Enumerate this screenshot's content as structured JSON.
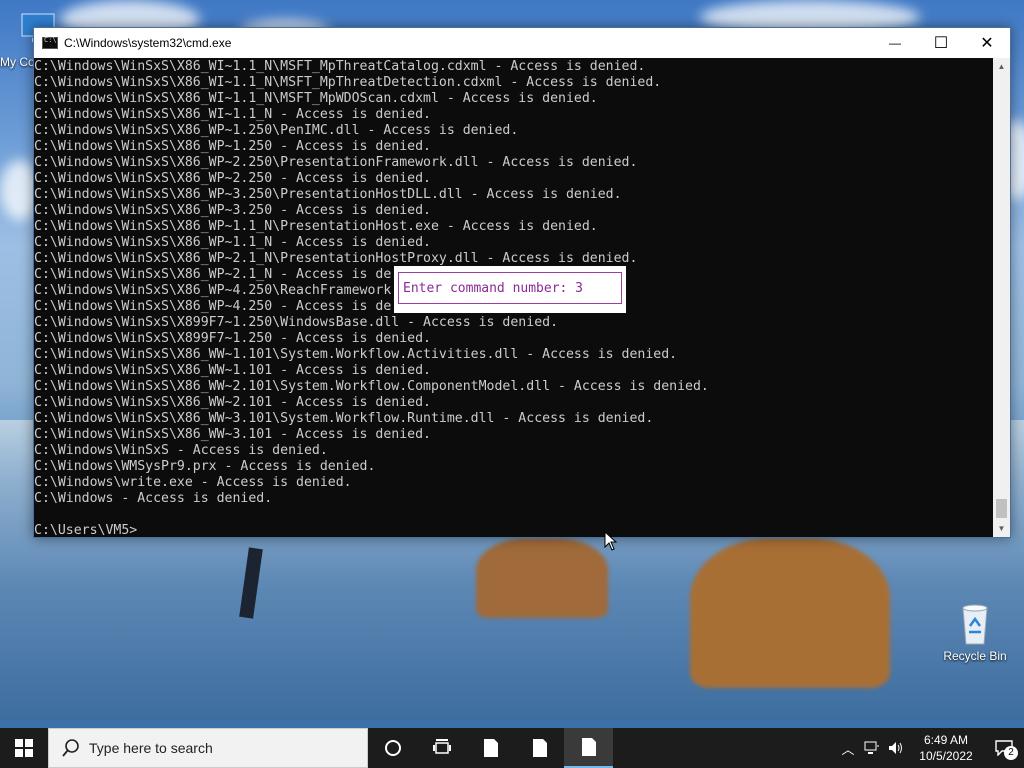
{
  "desktop": {
    "icons": [
      {
        "label": "My Co"
      },
      {
        "label": "Recycle Bin"
      }
    ]
  },
  "window": {
    "title": "C:\\Windows\\system32\\cmd.exe",
    "controls": {
      "minimize": "—",
      "maximize": "☐",
      "close": "✕"
    },
    "console_lines": [
      "C:\\Windows\\WinSxS\\X86_WI~1.1_N\\MSFT_MpThreatCatalog.cdxml - Access is denied.",
      "C:\\Windows\\WinSxS\\X86_WI~1.1_N\\MSFT_MpThreatDetection.cdxml - Access is denied.",
      "C:\\Windows\\WinSxS\\X86_WI~1.1_N\\MSFT_MpWDOScan.cdxml - Access is denied.",
      "C:\\Windows\\WinSxS\\X86_WI~1.1_N - Access is denied.",
      "C:\\Windows\\WinSxS\\X86_WP~1.250\\PenIMC.dll - Access is denied.",
      "C:\\Windows\\WinSxS\\X86_WP~1.250 - Access is denied.",
      "C:\\Windows\\WinSxS\\X86_WP~2.250\\PresentationFramework.dll - Access is denied.",
      "C:\\Windows\\WinSxS\\X86_WP~2.250 - Access is denied.",
      "C:\\Windows\\WinSxS\\X86_WP~3.250\\PresentationHostDLL.dll - Access is denied.",
      "C:\\Windows\\WinSxS\\X86_WP~3.250 - Access is denied.",
      "C:\\Windows\\WinSxS\\X86_WP~1.1_N\\PresentationHost.exe - Access is denied.",
      "C:\\Windows\\WinSxS\\X86_WP~1.1_N - Access is denied.",
      "C:\\Windows\\WinSxS\\X86_WP~2.1_N\\PresentationHostProxy.dll - Access is denied.",
      "C:\\Windows\\WinSxS\\X86_WP~2.1_N - Access is de",
      "C:\\Windows\\WinSxS\\X86_WP~4.250\\ReachFramework",
      "C:\\Windows\\WinSxS\\X86_WP~4.250 - Access is de",
      "C:\\Windows\\WinSxS\\X899F7~1.250\\WindowsBase.dll - Access is denied.",
      "C:\\Windows\\WinSxS\\X899F7~1.250 - Access is denied.",
      "C:\\Windows\\WinSxS\\X86_WW~1.101\\System.Workflow.Activities.dll - Access is denied.",
      "C:\\Windows\\WinSxS\\X86_WW~1.101 - Access is denied.",
      "C:\\Windows\\WinSxS\\X86_WW~2.101\\System.Workflow.ComponentModel.dll - Access is denied.",
      "C:\\Windows\\WinSxS\\X86_WW~2.101 - Access is denied.",
      "C:\\Windows\\WinSxS\\X86_WW~3.101\\System.Workflow.Runtime.dll - Access is denied.",
      "C:\\Windows\\WinSxS\\X86_WW~3.101 - Access is denied.",
      "C:\\Windows\\WinSxS - Access is denied.",
      "C:\\Windows\\WMSysPr9.prx - Access is denied.",
      "C:\\Windows\\write.exe - Access is denied.",
      "C:\\Windows - Access is denied.",
      "",
      "C:\\Users\\VM5>"
    ],
    "popup": {
      "text": "Enter command number: 3"
    }
  },
  "taskbar": {
    "search_placeholder": "Type here to search",
    "clock": {
      "time": "6:49 AM",
      "date": "10/5/2022"
    },
    "notification_count": "2"
  },
  "colors": {
    "console_bg": "#0c0c0c",
    "console_text": "#cccccc",
    "popup_text": "#8b2a96",
    "taskbar_bg": "#1c1c1c"
  }
}
